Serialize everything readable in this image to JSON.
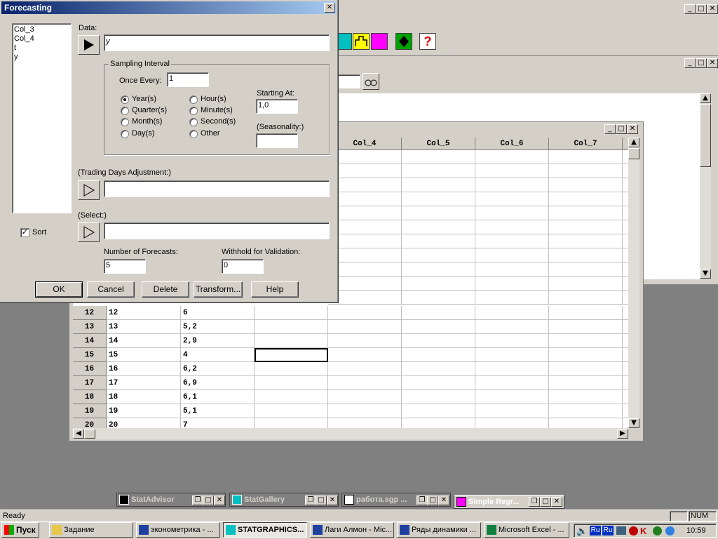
{
  "dialog": {
    "title": "Forecasting",
    "variables": [
      "Col_3",
      "Col_4",
      "t",
      "y"
    ],
    "sort_label": "Sort",
    "data_label": "Data:",
    "data_value": "y",
    "sampling": {
      "group_label": "Sampling Interval",
      "once_every_label": "Once Every:",
      "once_every_value": "1",
      "units": [
        "Year(s)",
        "Quarter(s)",
        "Month(s)",
        "Day(s)",
        "Hour(s)",
        "Minute(s)",
        "Second(s)",
        "Other"
      ],
      "selected": "Year(s)",
      "starting_at_label": "Starting At:",
      "starting_at_value": "1,0",
      "seasonality_label": "(Seasonality:)",
      "seasonality_value": ""
    },
    "trading_days_label": "(Trading Days Adjustment:)",
    "trading_days_value": "",
    "select_label": "(Select:)",
    "select_value": "",
    "forecasts_label": "Number of Forecasts:",
    "forecasts_value": "5",
    "withhold_label": "Withhold for Validation:",
    "withhold_value": "0",
    "buttons": {
      "ok": "OK",
      "cancel": "Cancel",
      "delete": "Delete",
      "transform": "Transform...",
      "help": "Help"
    }
  },
  "spreadsheet": {
    "columns": [
      "Col_4",
      "Col_5",
      "Col_6",
      "Col_7"
    ],
    "rows": [
      {
        "num": "12",
        "a": "12",
        "b": "6"
      },
      {
        "num": "13",
        "a": "13",
        "b": "5,2"
      },
      {
        "num": "14",
        "a": "14",
        "b": "2,9"
      },
      {
        "num": "15",
        "a": "15",
        "b": "4"
      },
      {
        "num": "16",
        "a": "16",
        "b": "6,2"
      },
      {
        "num": "17",
        "a": "17",
        "b": "6,9"
      },
      {
        "num": "18",
        "a": "18",
        "b": "6,1"
      },
      {
        "num": "19",
        "a": "19",
        "b": "5,1"
      },
      {
        "num": "20",
        "a": "20",
        "b": "7"
      }
    ]
  },
  "minimized_windows": [
    "StatAdvisor",
    "StatGallery",
    "работа.sgp ...",
    "Simple Regr..."
  ],
  "status": {
    "text": "Ready",
    "num": "NUM"
  },
  "taskbar": {
    "start": "Пуск",
    "tasks": [
      "Задание",
      "эконометрика - ...",
      "STATGRAPHICS...",
      "Лаги Алмон - Mic...",
      "Ряды динамики ...",
      "Microsoft Excel - ..."
    ],
    "clock": "10:59",
    "lang": "Ru"
  }
}
